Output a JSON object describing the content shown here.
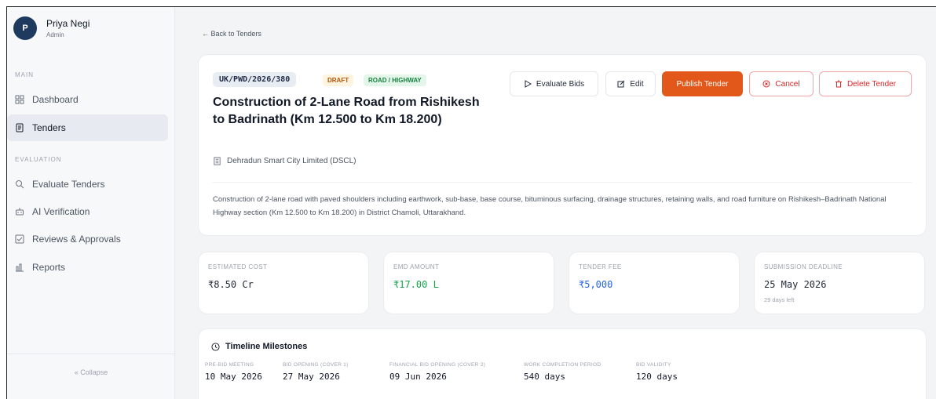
{
  "user": {
    "initial": "P",
    "name": "Priya Negi",
    "role": "Admin"
  },
  "sidebar": {
    "section_main": "MAIN",
    "section_evaluation": "EVALUATION",
    "items": [
      {
        "label": "Dashboard",
        "icon": "grid-icon"
      },
      {
        "label": "Tenders",
        "icon": "document-icon",
        "active": true
      },
      {
        "label": "Evaluate Tenders",
        "icon": "search-icon"
      },
      {
        "label": "AI Verification",
        "icon": "robot-icon"
      },
      {
        "label": "Reviews & Approvals",
        "icon": "checklist-icon"
      },
      {
        "label": "Reports",
        "icon": "bar-chart-icon"
      }
    ],
    "collapse_label": "« Collapse"
  },
  "header": {
    "back_label": "← Back to Tenders"
  },
  "tender": {
    "reference": "UK/PWD/2026/380",
    "status": "DRAFT",
    "category": "ROAD / HIGHWAY",
    "title": "Construction of 2-Lane Road from Rishikesh to Badrinath (Km 12.500 to Km 18.200)",
    "organization": "Dehradun Smart City Limited (DSCL)",
    "description": "Construction of 2-lane road with paved shoulders including earthwork, sub-base, base course, bituminous surfacing, drainage structures, retaining walls, and road furniture on Rishikesh–Badrinath National Highway section (Km 12.500 to Km 18.200) in District Chamoli, Uttarakhand."
  },
  "actions": {
    "evaluate": "Evaluate Bids",
    "edit": "Edit",
    "publish": "Publish Tender",
    "cancel": "Cancel",
    "delete": "Delete Tender"
  },
  "stats": [
    {
      "label": "ESTIMATED COST",
      "value": "₹8.50 Cr",
      "color": "#1f2937"
    },
    {
      "label": "EMD AMOUNT",
      "value": "₹17.00 L",
      "color": "#16a34a"
    },
    {
      "label": "TENDER FEE",
      "value": "₹5,000",
      "color": "#2563eb"
    },
    {
      "label": "SUBMISSION DEADLINE",
      "value": "25 May 2026",
      "sub": "29 days left",
      "color": "#1f2937"
    }
  ],
  "timeline": {
    "title": "Timeline Milestones",
    "milestones": [
      {
        "label": "PRE-BID MEETING",
        "value": "10 May 2026"
      },
      {
        "label": "BID OPENING (COVER 1)",
        "value": "27 May 2026"
      },
      {
        "label": "FINANCIAL BID OPENING (COVER 2)",
        "value": "09 Jun 2026"
      },
      {
        "label": "WORK COMPLETION PERIOD",
        "value": "540 days"
      },
      {
        "label": "BID VALIDITY",
        "value": "120 days"
      }
    ]
  },
  "colors": {
    "accent": "#e2571a",
    "danger": "#dc2626",
    "avatar": "#1e3a5f"
  }
}
